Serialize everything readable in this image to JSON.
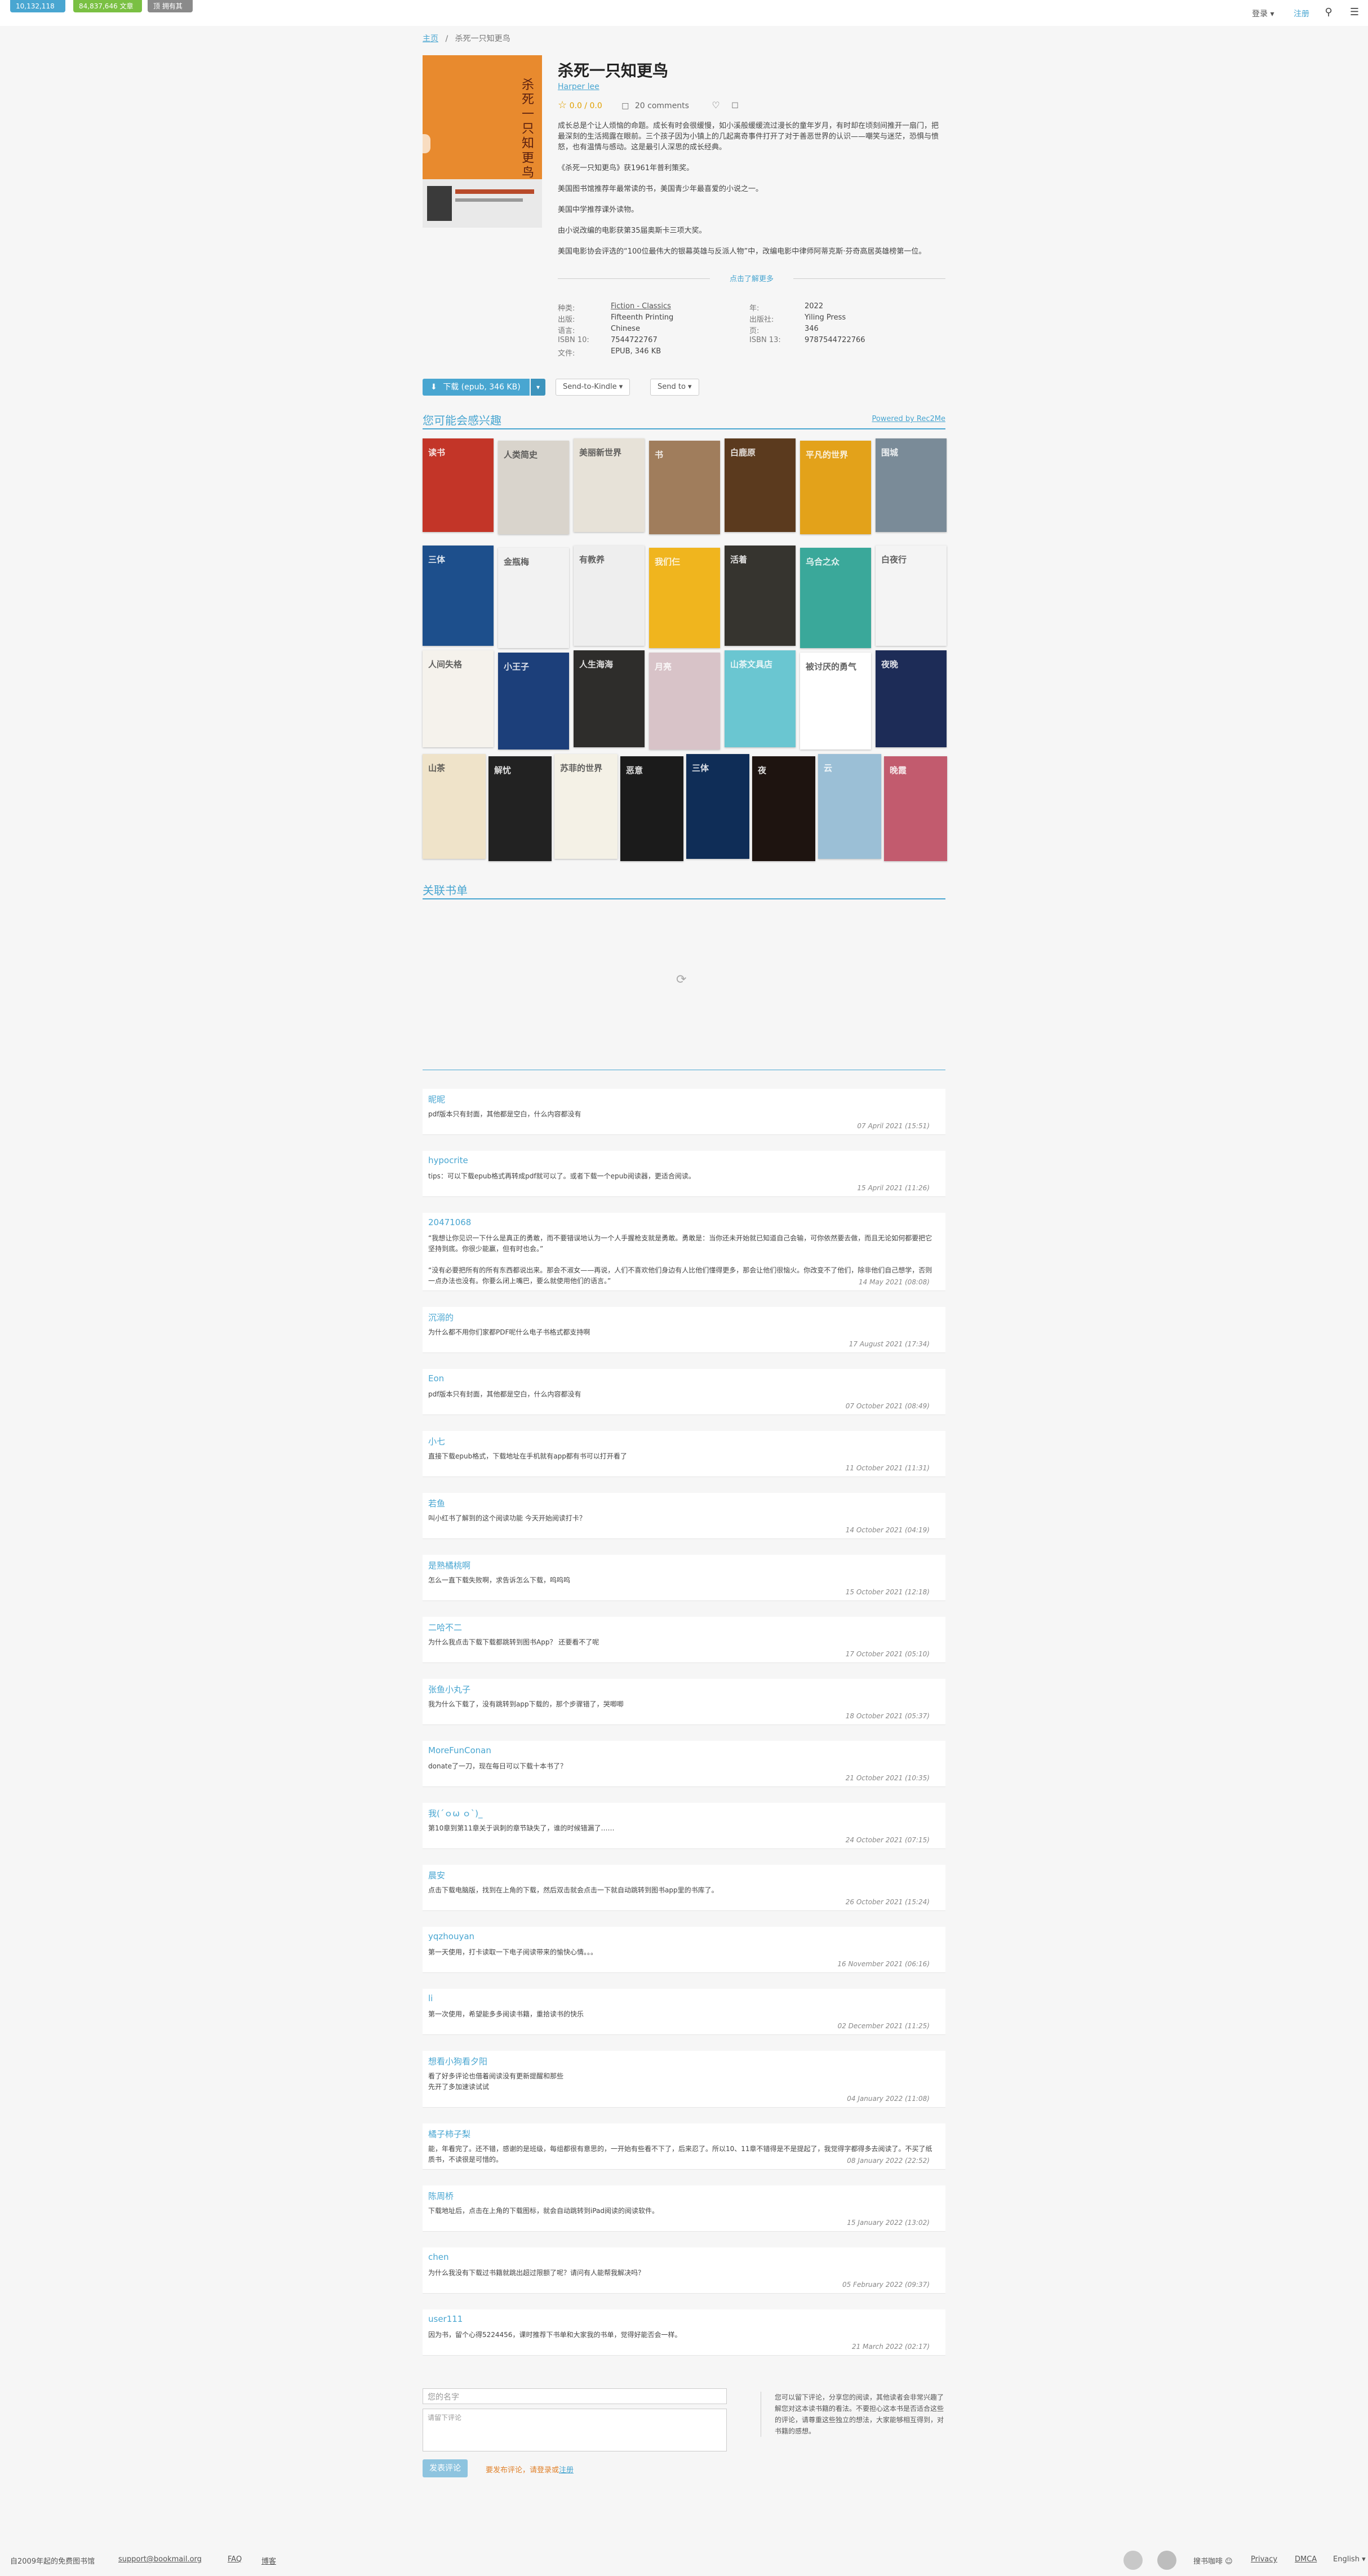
{
  "topbar": {
    "books_count": "10,132,118 书",
    "articles_count": "84,837,646 文章",
    "free_label": "顶 拥有其他",
    "lang": "登录 ▾",
    "login": "注册",
    "search_icon": "search-icon",
    "menu_icon": "menu-icon"
  },
  "breadcrumb": {
    "home": "主页",
    "sep": "/",
    "current": "杀死一只知更鸟"
  },
  "book": {
    "cover_title": "杀死一只知更鸟",
    "title": "杀死一只知更鸟",
    "author": "Harper lee",
    "rating": "0.0 / 0.0",
    "comments": "20 comments",
    "description": [
      "成长总是个让人烦恼的命题。成长有时会很缓慢，如小溪般缓缓流过漫长的童年岁月，有时却在顷刻间推开一扇门，把最深刻的生活揭露在眼前。三个孩子因为小镇上的几起离奇事件打开了对于善恶世界的认识——嘲笑与迷茫，恐惧与愤怒，也有温情与感动。这是最引人深思的成长经典。",
      "《杀死一只知更鸟》获1961年普利策奖。",
      "美国图书馆推荐年最常读的书，美国青少年最喜爱的小说之一。",
      "美国中学推荐课外读物。",
      "由小说改编的电影获第35届奥斯卡三项大奖。",
      "美国电影协会评选的“100位最伟大的银幕英雄与反派人物”中，改编电影中律师阿蒂克斯·芬奇高居英雄榜第一位。"
    ],
    "more": "点击了解更多"
  },
  "props": {
    "category_k": "种类:",
    "category_v": "Fiction - Classics",
    "content_type_k": "出版:",
    "content_type_v": "Fifteenth Printing",
    "language_k": "语言:",
    "language_v": "Chinese",
    "isbn10_k": "ISBN 10:",
    "isbn10_v": "7544722767",
    "file_k": "文件:",
    "file_v": "EPUB, 346 KB",
    "year_k": "年:",
    "year_v": "2022",
    "publisher_k": "出版社:",
    "publisher_v": "Yiling Press",
    "pages_k": "页:",
    "pages_v": "346",
    "isbn13_k": "ISBN 13:",
    "isbn13_v": "9787544722766"
  },
  "actions": {
    "download": "下载 (epub, 346 KB)",
    "send_kindle": "Send-to-Kindle ▾",
    "send_to": "Send to ▾"
  },
  "recommend": {
    "title": "您可能会感兴趣",
    "powered": "Powered by Rec2Me",
    "books": [
      {
        "t": "读书",
        "c": "#c33528"
      },
      {
        "t": "人类简史",
        "c": "#d9d4cc"
      },
      {
        "t": "美丽新世界",
        "c": "#e7e2d8"
      },
      {
        "t": "书",
        "c": "#a07d5c"
      },
      {
        "t": "白鹿原",
        "c": "#5b3a1e"
      },
      {
        "t": "平凡的世界",
        "c": "#e3a21a"
      },
      {
        "t": "围城",
        "c": "#7a8b98"
      },
      {
        "t": "三体",
        "c": "#1d4f8c"
      },
      {
        "t": "金瓶梅",
        "c": "#f2f2f2"
      },
      {
        "t": "有教养",
        "c": "#eeeeee"
      },
      {
        "t": "我们仨",
        "c": "#f0b51e"
      },
      {
        "t": "活着",
        "c": "#36342f"
      },
      {
        "t": "乌合之众",
        "c": "#3aa89a"
      },
      {
        "t": "白夜行",
        "c": "#f4f4f4"
      },
      {
        "t": "人间失格",
        "c": "#f5f2ec"
      },
      {
        "t": "小王子",
        "c": "#1c3f7a"
      },
      {
        "t": "人生海海",
        "c": "#2e2d2b"
      },
      {
        "t": "月亮",
        "c": "#d8c3c8"
      },
      {
        "t": "山茶文具店",
        "c": "#6ac6d1"
      },
      {
        "t": "被讨厌的勇气",
        "c": "#ffffff"
      },
      {
        "t": "夜晚",
        "c": "#1d2c57"
      },
      {
        "t": "山茶",
        "c": "#efe3c9"
      },
      {
        "t": "解忧",
        "c": "#222222"
      },
      {
        "t": "苏菲的世界",
        "c": "#f4f1e6"
      },
      {
        "t": "恶意",
        "c": "#1b1b1b"
      },
      {
        "t": "三体",
        "c": "#0f2d57"
      },
      {
        "t": "夜",
        "c": "#1e1410"
      },
      {
        "t": "云",
        "c": "#9bbfd6"
      },
      {
        "t": "晚霞",
        "c": "#c25b6e"
      }
    ]
  },
  "booklists": {
    "title": "关联书单",
    "loading": "⟳"
  },
  "comments": [
    {
      "user": "昵昵",
      "text": "pdf版本只有封面，其他都是空白，什么内容都没有",
      "date": "07 April 2021 (15:51)"
    },
    {
      "user": "hypocrite",
      "text": "tips：可以下载epub格式再转成pdf就可以了。或者下载一个epub阅读器，更适合阅读。",
      "date": "15 April 2021 (11:26)"
    },
    {
      "user": "20471068",
      "text": "“我想让你见识一下什么是真正的勇敢，而不要错误地认为一个人手握枪支就是勇敢。勇敢是：当你还未开始就已知道自己会输，可你依然要去做，而且无论如何都要把它坚持到底。你很少能赢，但有时也会。”\n\n“没有必要把所有的所有东西都说出来。那会不淑女——再说，人们不喜欢他们身边有人比他们懂得更多，那会让他们很恼火。你改变不了他们，除非他们自己想学，否则一点办法也没有。你要么闭上嘴巴，要么就使用他们的语言。”",
      "date": "14 May 2021 (08:08)"
    },
    {
      "user": "沉溺的",
      "text": "为什么都不用你们家都PDF呢什么电子书格式都支持啊",
      "date": "17 August 2021 (17:34)"
    },
    {
      "user": "Eon",
      "text": "pdf版本只有封面，其他都是空白，什么内容都没有",
      "date": "07 October 2021 (08:49)"
    },
    {
      "user": "小七",
      "text": "直接下载epub格式，下载地址在手机就有app都有书可以打开看了",
      "date": "11 October 2021 (11:31)"
    },
    {
      "user": "若鱼",
      "text": "叫小红书了解到的这个阅读功能 今天开始阅读打卡？",
      "date": "14 October 2021 (04:19)"
    },
    {
      "user": "是熟橘桃啊",
      "text": "怎么一直下载失败啊，求告诉怎么下载，呜呜呜",
      "date": "15 October 2021 (12:18)"
    },
    {
      "user": "二哈不二",
      "text": "为什么我点击下载下载都跳转到图书App？ 还要看不了呢",
      "date": "17 October 2021 (05:10)"
    },
    {
      "user": "张鱼小丸子",
      "text": "我为什么下载了，没有跳转到app下载的，那个步骤错了，哭唧唧",
      "date": "18 October 2021 (05:37)"
    },
    {
      "user": "MoreFunConan",
      "text": "donate了一刀，现在每日可以下载十本书了？",
      "date": "21 October 2021 (10:35)"
    },
    {
      "user": "我(´ｏω ｏ`)_",
      "text": "第10章到第11章关于讽刺的章节缺失了，谁的时候错漏了……",
      "date": "24 October 2021 (07:15)"
    },
    {
      "user": "晨安",
      "text": "点击下载电脑版，找到在上角的下载，然后双击就会点击一下就自动跳转到图书app里的书库了。",
      "date": "26 October 2021 (15:24)"
    },
    {
      "user": "yqzhouyan",
      "text": "第一天使用，打卡读取一下电子阅读带来的愉快心情。。。",
      "date": "16 November 2021 (06:16)"
    },
    {
      "user": "li",
      "text": "第一次使用，希望能多多阅读书籍，重拾读书的快乐",
      "date": "02 December 2021 (11:25)"
    },
    {
      "user": "想看小狗看夕阳",
      "text": "看了好多评论也借着阅读没有更新提醒和那些\n先开了多加速读试试",
      "date": "04 January 2022 (11:08)"
    },
    {
      "user": "橘子柿子梨",
      "text": "能，年看完了。还不错，感谢的是班级，每组都很有意思的，一开始有些看不下了，后来忍了。所以10、11章不错得是不是提起了，我觉得字都得多去阅读了。不买了纸质书，不读很是可惜的。",
      "date": "08 January 2022 (22:52)"
    },
    {
      "user": "陈周桥",
      "text": "下载地址后，点击在上角的下载图标，就会自动跳转到iPad阅读的阅读软件。",
      "date": "15 January 2022 (13:02)"
    },
    {
      "user": "chen",
      "text": "为什么我没有下载过书籍就跳出超过限额了呢？请问有人能帮我解决吗？",
      "date": "05 February 2022 (09:37)"
    },
    {
      "user": "user111",
      "text": "因为书，留个心得5224456，课时推荐下书单和大家我的书单，觉得好能否会一样。",
      "date": "21 March 2022 (02:17)"
    }
  ],
  "form": {
    "name_placeholder": "您的名字",
    "text_placeholder": "请留下评论",
    "rules": "您可以留下评论，分享您的阅读，其他读者会非常兴趣了解您对这本读书籍的看法。不要担心这本书是否适合这些的评论，请尊重这些独立的想法，大家能够相互得到，对书籍的感想。",
    "send": "发表评论",
    "warn_pre": "要发布评论，请登录或",
    "warn_link": "注册"
  },
  "footer": {
    "copyright": "自2009年起的免费图书馆",
    "email": "support@bookmail.org",
    "faq": "FAQ",
    "blog": "博客",
    "extra": "搜书咖啡 ☺",
    "privacy": "Privacy",
    "dmca": "DMCA",
    "lang": "English ▾"
  }
}
